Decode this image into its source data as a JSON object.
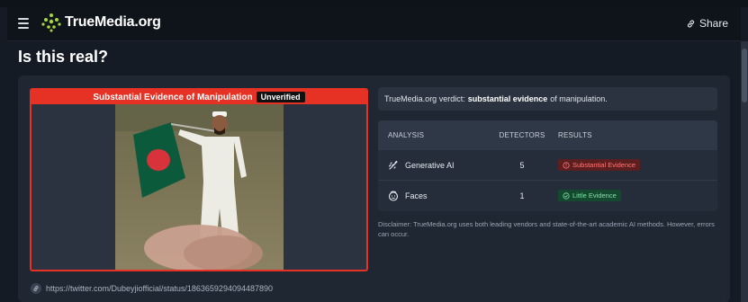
{
  "header": {
    "logo_text": "TrueMedia.org",
    "share_label": "Share"
  },
  "page": {
    "title": "Is this real?"
  },
  "media": {
    "banner_text": "Substantial Evidence of Manipulation",
    "status_tag": "Unverified",
    "source_url": "https://twitter.com/Dubeyjiofficial/status/1863659294094487890"
  },
  "verdict": {
    "prefix": "TrueMedia.org verdict:",
    "emphasis": "substantial evidence",
    "suffix": "of manipulation."
  },
  "analysis_table": {
    "headers": [
      "ANALYSIS",
      "DETECTORS",
      "RESULTS"
    ],
    "rows": [
      {
        "analysis": "Generative AI",
        "icon": "generative-ai-icon",
        "detectors": "5",
        "result": "Substantial Evidence",
        "result_color": "#ff7a7a"
      },
      {
        "analysis": "Faces",
        "icon": "face-icon",
        "detectors": "1",
        "result": "Little Evidence",
        "result_color": "#7fe3a6"
      }
    ]
  },
  "disclaimer": "Disclaimer: TrueMedia.org uses both leading vendors and state-of-the-art academic AI methods. However, errors can occur.",
  "colors": {
    "accent_red": "#e63224",
    "logo_green": "#a7d83a",
    "background": "#151b24"
  }
}
